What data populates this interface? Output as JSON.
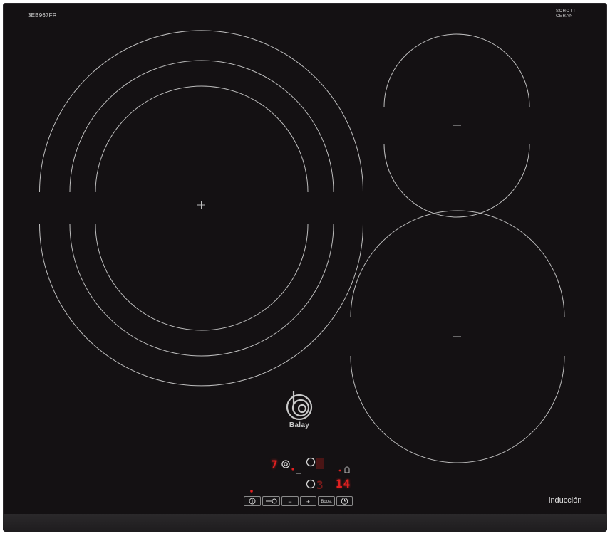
{
  "model_code": "3EB967FR",
  "glass_brand": {
    "line1": "SCHOTT",
    "line2": "CERAN",
    "fine_print": "SCHOTT"
  },
  "brand": "Balay",
  "type_label": "inducción",
  "controls": {
    "display_left_digit": "7",
    "display_right_level": "3",
    "timer_value": "14",
    "buttons": [
      {
        "id": "power",
        "label": "",
        "icon": "power-icon"
      },
      {
        "id": "lock",
        "label": "",
        "icon": "key-lock-icon"
      },
      {
        "id": "minus",
        "label": "−"
      },
      {
        "id": "plus",
        "label": "+"
      },
      {
        "id": "boost",
        "label": "Boost"
      },
      {
        "id": "timer",
        "label": "",
        "icon": "clock-icon"
      }
    ]
  },
  "colors": {
    "glass": "#141113",
    "zone_line": "#bdbdbd",
    "display_red": "#e02020"
  }
}
